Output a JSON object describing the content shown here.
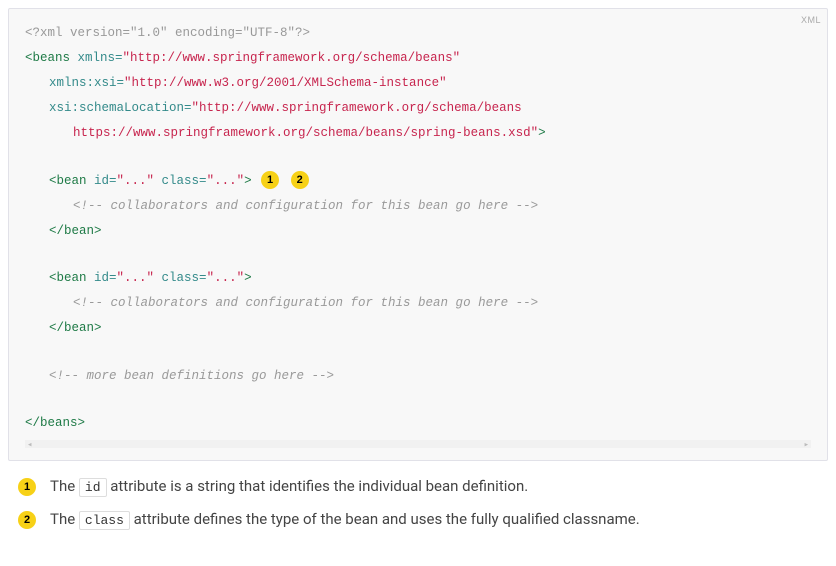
{
  "lang_label": "XML",
  "code": {
    "l1_pi": "<?xml version=\"1.0\" encoding=\"UTF-8\"?>",
    "beans_open_tag": "<beans",
    "beans_xmlns_attr": " xmlns=",
    "beans_xmlns_val": "\"http://www.springframework.org/schema/beans\"",
    "beans_xsi_attr": "xmlns:xsi=",
    "beans_xsi_val": "\"http://www.w3.org/2001/XMLSchema-instance\"",
    "beans_loc_attr": "xsi:schemaLocation=",
    "beans_loc_val1": "\"http://www.springframework.org/schema/beans",
    "beans_loc_val2": "https://www.springframework.org/schema/beans/spring-beans.xsd\"",
    "beans_open_close": ">",
    "bean1_open": "<bean",
    "bean1_id_attr": " id=",
    "bean1_id_val": "\"...\"",
    "bean1_class_attr": " class=",
    "bean1_class_val": "\"...\"",
    "bean1_open_close": ">",
    "bean1_comment": "<!-- collaborators and configuration for this bean go here -->",
    "bean_close": "</bean>",
    "bean2_open": "<bean",
    "bean2_id_attr": " id=",
    "bean2_id_val": "\"...\"",
    "bean2_class_attr": " class=",
    "bean2_class_val": "\"...\"",
    "bean2_open_close": ">",
    "bean2_comment": "<!-- collaborators and configuration for this bean go here -->",
    "more_comment": "<!-- more bean definitions go here -->",
    "beans_close": "</beans>"
  },
  "callouts": {
    "n1": "1",
    "n2": "2",
    "c1_pre": "The ",
    "c1_code": "id",
    "c1_post": " attribute is a string that identifies the individual bean definition.",
    "c2_pre": "The ",
    "c2_code": "class",
    "c2_post": " attribute defines the type of the bean and uses the fully qualified classname."
  }
}
